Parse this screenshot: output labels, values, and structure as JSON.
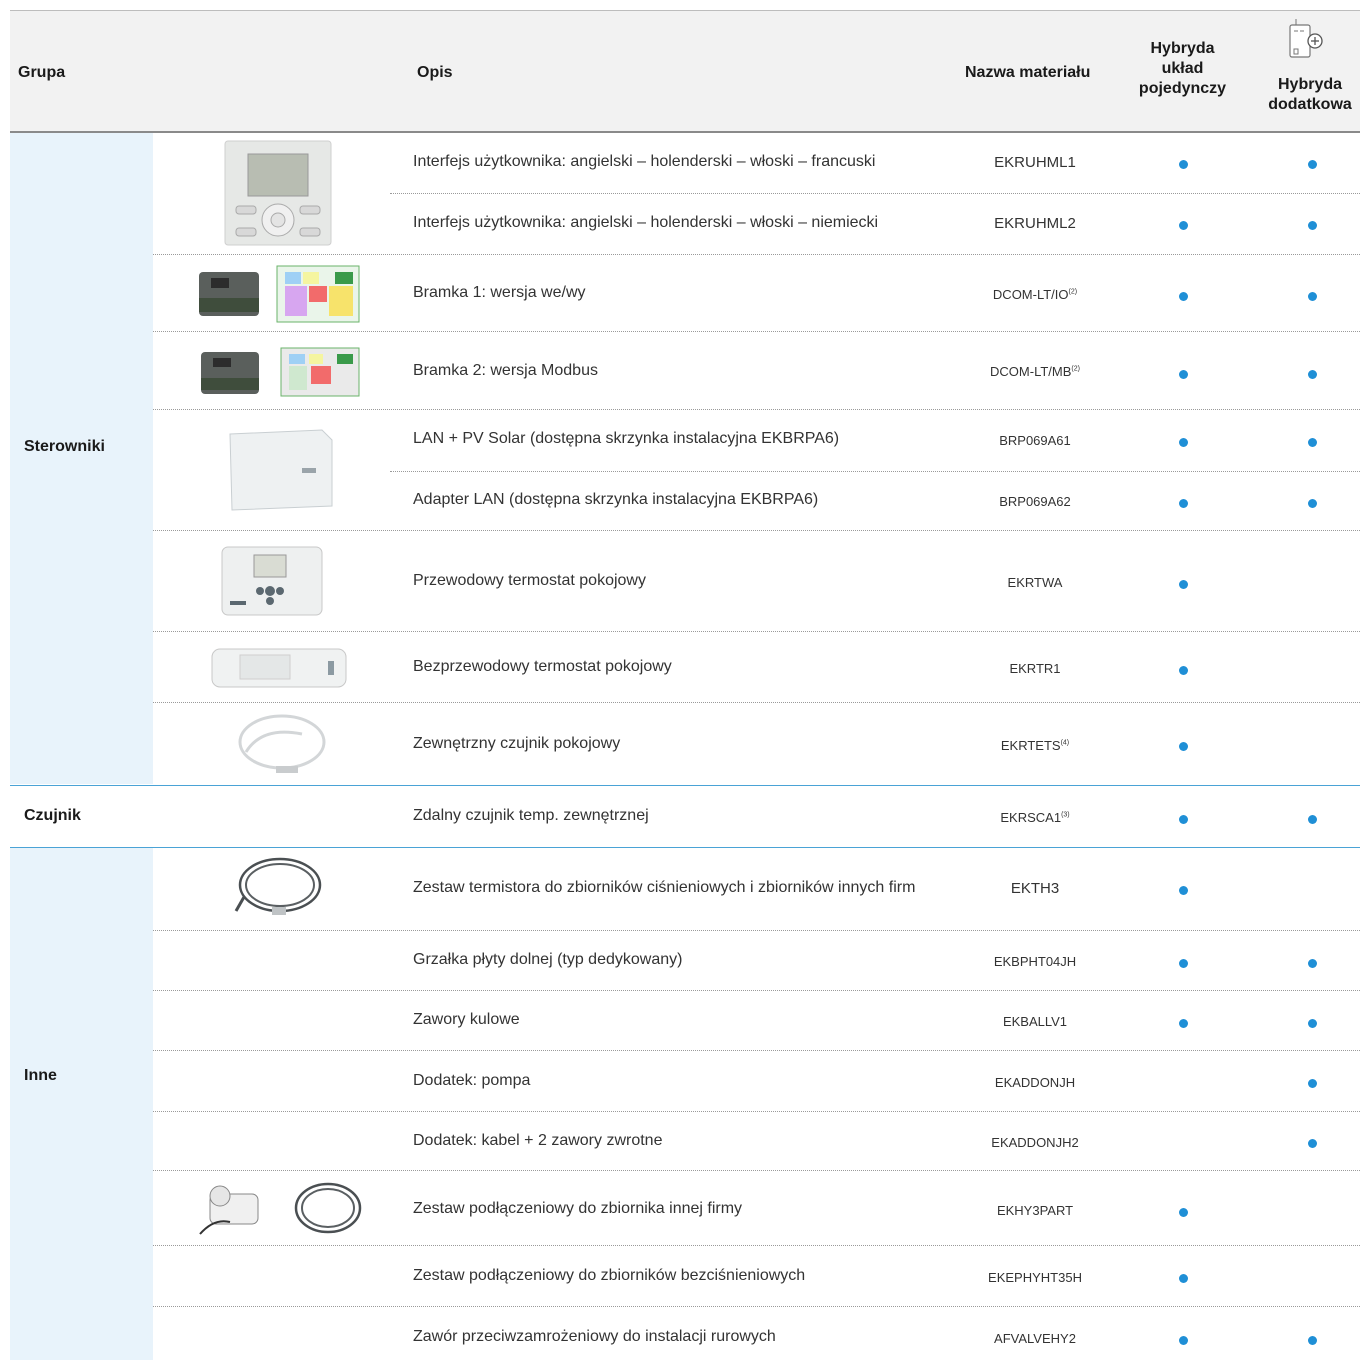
{
  "header": {
    "grupa": "Grupa",
    "opis": "Opis",
    "nazwa": "Nazwa materiału",
    "single": "Hybryda układ pojedynczy",
    "extra": "Hybryda dodatkowa",
    "extra_icon": "hybrid-addon-unit-icon"
  },
  "groups": {
    "sterowniki": "Sterowniki",
    "czujnik": "Czujnik",
    "inne": "Inne"
  },
  "rows": [
    {
      "desc": "Interfejs użytkownika: angielski – holenderski – włoski – francuski",
      "code": "EKRUHML1",
      "single": true,
      "extra": true
    },
    {
      "desc": "Interfejs użytkownika: angielski – holenderski – włoski – niemiecki",
      "code": "EKRUHML2",
      "single": true,
      "extra": true
    },
    {
      "desc": "Bramka 1: wersja we/wy",
      "code": "DCOM-LT/IO",
      "sup": "(2)",
      "single": true,
      "extra": true
    },
    {
      "desc": "Bramka 2: wersja Modbus",
      "code": "DCOM-LT/MB",
      "sup": "(2)",
      "single": true,
      "extra": true
    },
    {
      "desc": "LAN + PV Solar (dostępna skrzynka instalacyjna EKBRPA6)",
      "code": "BRP069A61",
      "single": true,
      "extra": true
    },
    {
      "desc": "Adapter LAN (dostępna skrzynka instalacyjna EKBRPA6)",
      "code": "BRP069A62",
      "single": true,
      "extra": true
    },
    {
      "desc": "Przewodowy termostat pokojowy",
      "code": "EKRTWA",
      "single": true,
      "extra": false
    },
    {
      "desc": "Bezprzewodowy termostat pokojowy",
      "code": "EKRTR1",
      "single": true,
      "extra": false
    },
    {
      "desc": "Zewnętrzny czujnik pokojowy",
      "code": "EKRTETS",
      "sup": "(4)",
      "single": true,
      "extra": false
    },
    {
      "desc": "Zdalny czujnik temp. zewnętrznej",
      "code": "EKRSCA1",
      "sup": "(3)",
      "single": true,
      "extra": true
    },
    {
      "desc": "Zestaw termistora do zbiorników ciśnieniowych i zbiorników innych firm",
      "code": "EKTH3",
      "single": true,
      "extra": false
    },
    {
      "desc": "Grzałka płyty dolnej (typ dedykowany)",
      "code": "EKBPHT04JH",
      "single": true,
      "extra": true
    },
    {
      "desc": "Zawory kulowe",
      "code": "EKBALLV1",
      "single": true,
      "extra": true
    },
    {
      "desc": "Dodatek: pompa",
      "code": "EKADDONJH",
      "single": false,
      "extra": true
    },
    {
      "desc": "Dodatek: kabel + 2 zawory zwrotne",
      "code": "EKADDONJH2",
      "single": false,
      "extra": true
    },
    {
      "desc": "Zestaw podłączeniowy do zbiornika innej firmy",
      "code": "EKHY3PART",
      "single": true,
      "extra": false
    },
    {
      "desc": "Zestaw podłączeniowy do zbiorników bezciśnieniowych",
      "code": "EKEPHYHT35H",
      "single": true,
      "extra": false
    },
    {
      "desc": "Zawór przeciwzamrożeniowy do instalacji rurowych",
      "code": "AFVALVEHY2",
      "single": true,
      "extra": true
    }
  ],
  "colors": {
    "dot": "#1f8fd6",
    "band": "#e8f3fb",
    "rule": "#4aa3d6",
    "header_bg": "#f2f2f2"
  }
}
